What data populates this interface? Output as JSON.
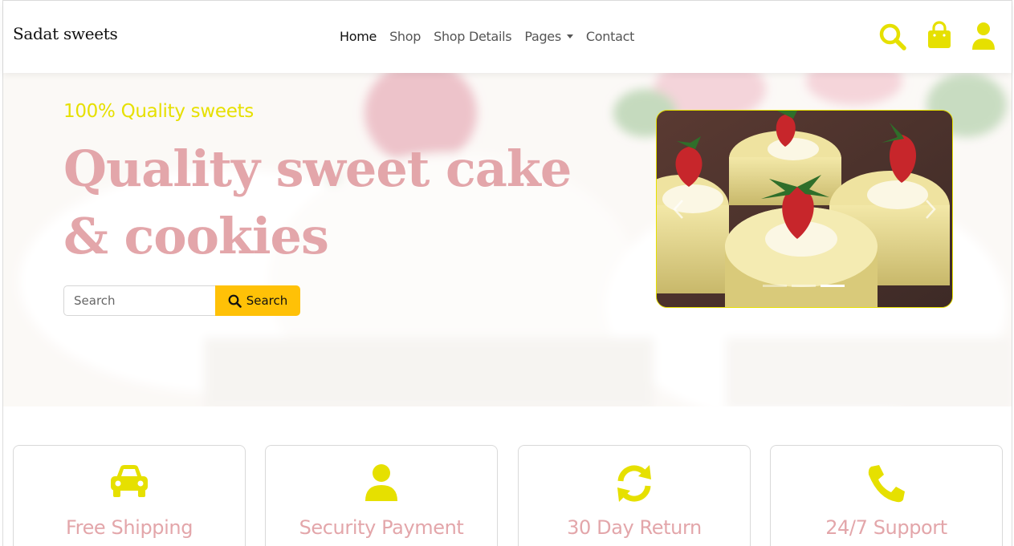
{
  "brand": {
    "name": "Sadat sweets"
  },
  "nav": {
    "items": [
      {
        "label": "Home",
        "active": true
      },
      {
        "label": "Shop"
      },
      {
        "label": "Shop Details"
      },
      {
        "label": "Pages",
        "dropdown": true
      },
      {
        "label": "Contact"
      }
    ],
    "icons": [
      "search-icon",
      "shopping-bag-icon",
      "user-icon"
    ]
  },
  "hero": {
    "subtitle": "100% Quality sweets",
    "title": "Quality sweet cake & cookies",
    "search": {
      "placeholder": "Search",
      "button_label": "Search"
    },
    "carousel": {
      "slide_count": 3,
      "active_index": 2
    }
  },
  "features": [
    {
      "label": "Free Shipping",
      "icon": "car-icon"
    },
    {
      "label": "Security Payment",
      "icon": "user-icon"
    },
    {
      "label": "30 Day Return",
      "icon": "sync-icon"
    },
    {
      "label": "24/7 Support",
      "icon": "phone-icon"
    }
  ],
  "colors": {
    "accent_yellow": "#e6e000",
    "button_yellow": "#ffc107",
    "title_pink": "#e3a6aa"
  }
}
